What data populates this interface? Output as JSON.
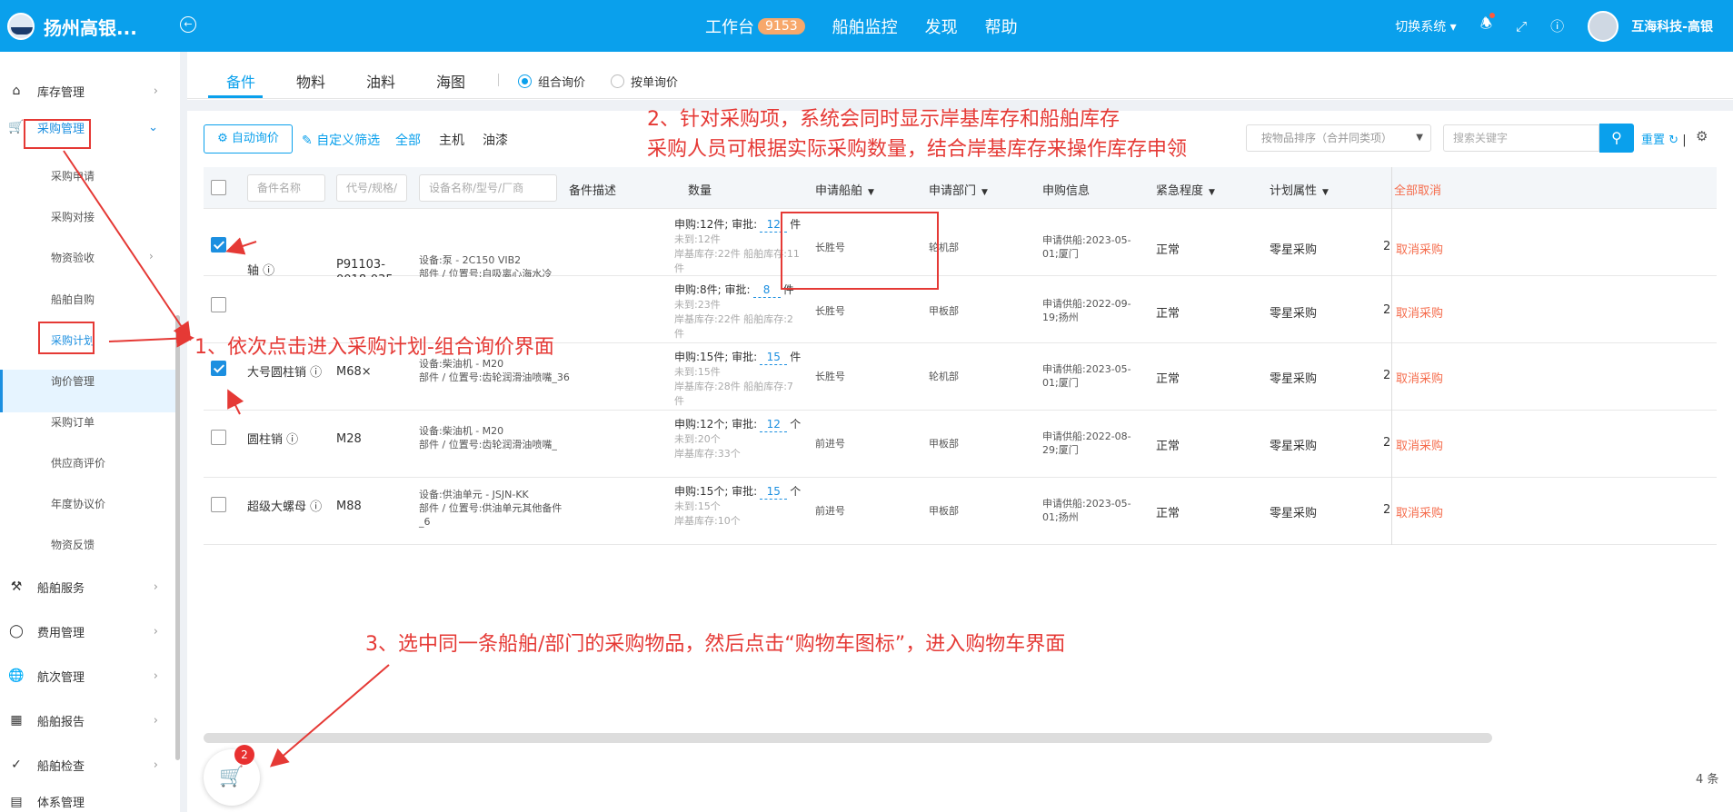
{
  "header": {
    "brand": "扬州高银...",
    "nav": [
      {
        "label": "工作台",
        "badge": "9153"
      },
      {
        "label": "船舶监控"
      },
      {
        "label": "发现"
      },
      {
        "label": "帮助"
      }
    ],
    "switch_system": "切换系统",
    "user": "互海科技-高银"
  },
  "sidebar": {
    "items": [
      {
        "label": "库存管理",
        "icon": "home-icon"
      },
      {
        "label": "采购管理",
        "icon": "cart-icon"
      },
      {
        "label": "船舶服务",
        "icon": "tools-icon"
      },
      {
        "label": "费用管理",
        "icon": "coins-icon"
      },
      {
        "label": "航次管理",
        "icon": "globe-icon"
      },
      {
        "label": "船舶报告",
        "icon": "calendar-icon"
      },
      {
        "label": "船舶检查",
        "icon": "check-circle-icon"
      },
      {
        "label": "体系管理",
        "icon": "system-icon"
      }
    ],
    "sub_items": [
      "采购申请",
      "采购对接",
      "物资验收",
      "船舶自购",
      "采购计划",
      "询价管理",
      "采购订单",
      "供应商评价",
      "年度协议价",
      "物资反馈"
    ]
  },
  "tabs": [
    "备件",
    "物料",
    "油料",
    "海图"
  ],
  "radios": [
    "组合询价",
    "按单询价"
  ],
  "toolbar": {
    "auto_inquiry": "自动询价",
    "custom_filter": "自定义筛选",
    "filters": [
      "全部",
      "主机",
      "油漆"
    ],
    "sort_select": "按物品排序（合并同类项）",
    "search_placeholder": "搜索关键字",
    "reset": "重置"
  },
  "table": {
    "filter_placeholders": [
      "备件名称",
      "代号/规格/",
      "设备名称/型号/厂商"
    ],
    "headers": [
      "备件描述",
      "数量",
      "申请船舶",
      "申请部门",
      "申购信息",
      "紧急程度",
      "计划属性"
    ],
    "cancel_all": "全部取消",
    "rows": [
      {
        "checked": true,
        "name": "轴",
        "code": "P91103-0018-035",
        "desc1": "设备:泵 - 2C150 VIB2",
        "desc2": "部件 / 位置号:自吸离心海水冷却泵_",
        "req": "申购:12件; 审批:",
        "approve": "12",
        "unit": "件",
        "arrive": "未到:12件",
        "stock": "岸基库存:22件 船舶库存:11件",
        "ship": "长胜号",
        "dept": "轮机部",
        "info": "申请供船:2023-05-01;厦门",
        "urgency": "正常",
        "attr": "零星采购",
        "extra": "2",
        "cancel": "取消采购"
      },
      {
        "checked": false,
        "name": "",
        "code": "",
        "desc1": "",
        "desc2": "",
        "req": "申购:8件; 审批:",
        "approve": "8",
        "unit": "件",
        "arrive": "未到:23件",
        "stock": "岸基库存:22件 船舶库存:2件",
        "ship": "长胜号",
        "dept": "甲板部",
        "info": "申请供船:2022-09-19;扬州",
        "urgency": "正常",
        "attr": "零星采购",
        "extra": "2",
        "cancel": "取消采购"
      },
      {
        "checked": true,
        "name": "大号圆柱销",
        "code": "M68×",
        "desc1": "设备:柴油机 - M20",
        "desc2": "部件 / 位置号:齿轮润滑油喷嘴_36",
        "req": "申购:15件; 审批:",
        "approve": "15",
        "unit": "件",
        "arrive": "未到:15件",
        "stock": "岸基库存:28件 船舶库存:7件",
        "ship": "长胜号",
        "dept": "轮机部",
        "info": "申请供船:2023-05-01;厦门",
        "urgency": "正常",
        "attr": "零星采购",
        "extra": "2",
        "cancel": "取消采购"
      },
      {
        "checked": false,
        "name": "圆柱销",
        "code": "M28",
        "desc1": "设备:柴油机 - M20",
        "desc2": "部件 / 位置号:齿轮润滑油喷嘴_",
        "req": "申购:12个; 审批:",
        "approve": "12",
        "unit": "个",
        "arrive": "未到:20个",
        "stock": "岸基库存:33个",
        "ship": "前进号",
        "dept": "甲板部",
        "info": "申请供船:2022-08-29;厦门",
        "urgency": "正常",
        "attr": "零星采购",
        "extra": "2",
        "cancel": "取消采购"
      },
      {
        "checked": false,
        "name": "超级大螺母",
        "code": "M88",
        "desc1": "设备:供油单元 - JSJN-KK",
        "desc2": "部件 / 位置号:供油单元其他备件_6",
        "req": "申购:15个; 审批:",
        "approve": "15",
        "unit": "个",
        "arrive": "未到:15个",
        "stock": "岸基库存:10个",
        "ship": "前进号",
        "dept": "甲板部",
        "info": "申请供船:2023-05-01;扬州",
        "urgency": "正常",
        "attr": "零星采购",
        "extra": "2",
        "cancel": "取消采购"
      }
    ]
  },
  "cart": {
    "count": "2"
  },
  "footer": {
    "total": "4 条"
  },
  "annotations": {
    "note1": "1、依次点击进入采购计划-组合询价界面",
    "note2a": "2、针对采购项，系统会同时显示岸基库存和船舶库存",
    "note2b": "采购人员可根据实际采购数量，结合岸基库存来操作库存申领",
    "note3": "3、选中同一条船舶/部门的采购物品，然后点击“购物车图标”，进入购物车界面"
  },
  "colors": {
    "primary": "#0aa0ec",
    "annotation": "#e53935",
    "cancel": "#f56c4c"
  }
}
